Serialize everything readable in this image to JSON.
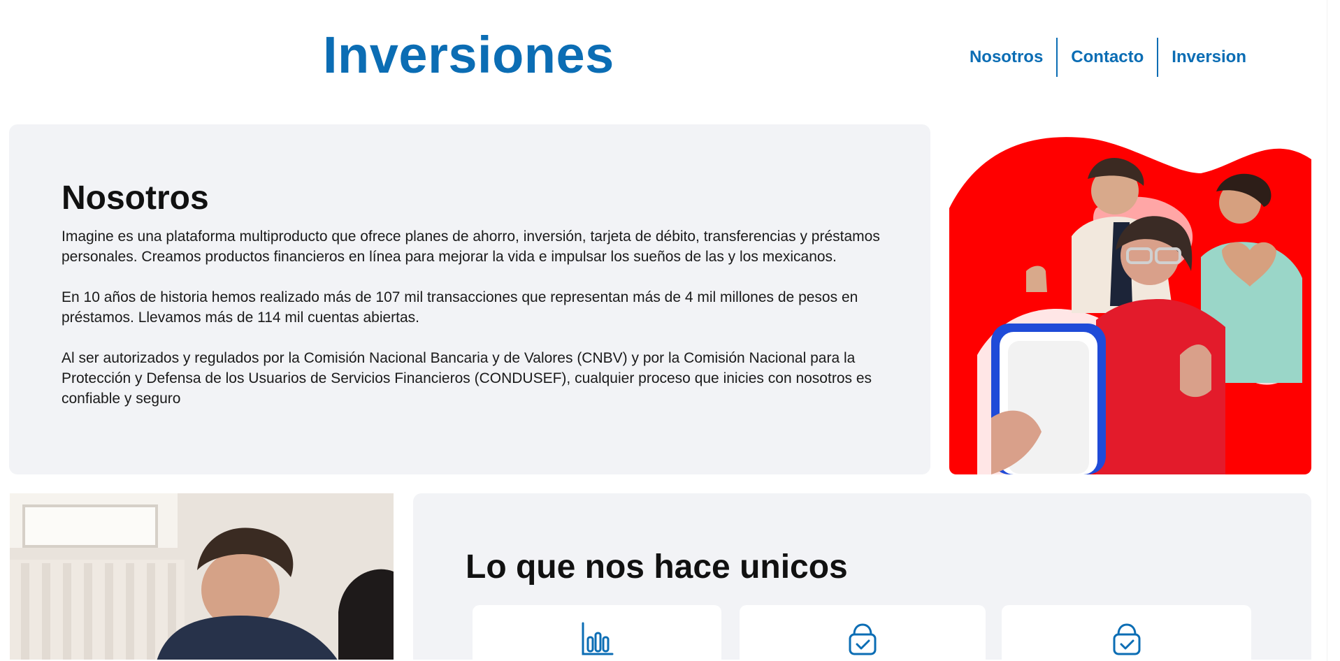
{
  "header": {
    "title": "Inversiones",
    "nav": [
      {
        "label": "Nosotros"
      },
      {
        "label": "Contacto"
      },
      {
        "label": "Inversion"
      }
    ]
  },
  "about": {
    "heading": "Nosotros",
    "paragraphs": [
      "Imagine es una plataforma multiproducto que ofrece planes de ahorro, inversión, tarjeta de débito, transferencias y préstamos personales. Creamos productos financieros en línea para mejorar la vida e impulsar los sueños de las y los mexicanos.",
      "En 10 años de historia hemos realizado más de 107 mil transacciones que representan más de 4 mil millones de pesos en préstamos. Llevamos más de 114 mil cuentas abiertas.",
      "Al ser autorizados y regulados por la Comisión Nacional Bancaria y de Valores (CNBV) y por la Comisión Nacional para la Protección y Defensa de los Usuarios de Servicios Financieros (CONDUSEF), cualquier proceso que inicies con nosotros es confiable y seguro"
    ]
  },
  "unique": {
    "heading": "Lo que nos hace unicos",
    "features": [
      {
        "icon": "bar-chart-icon"
      },
      {
        "icon": "shopping-bag-check-icon"
      },
      {
        "icon": "shopping-bag-check-icon"
      }
    ]
  },
  "colors": {
    "brand_blue": "#0b6db4",
    "card_bg": "#f2f3f6",
    "hero_red": "#ff0000"
  }
}
